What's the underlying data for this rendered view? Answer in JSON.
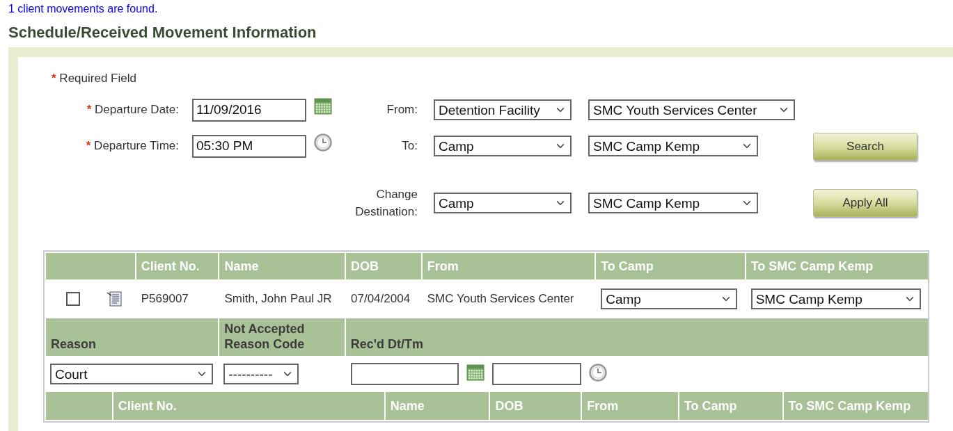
{
  "status_message": "1 client movements are found.",
  "section_title": "Schedule/Received Movement Information",
  "form": {
    "required_note": {
      "mark": "*",
      "text": "Required Field"
    },
    "departure_date": {
      "required_mark": "*",
      "label": "Departure Date:",
      "value": "11/09/2016"
    },
    "departure_time": {
      "required_mark": "*",
      "label": "Departure Time:",
      "value": "05:30 PM"
    },
    "from": {
      "label": "From:",
      "type": "Detention Facility",
      "facility": "SMC Youth Services Center"
    },
    "to": {
      "label": "To:",
      "type": "Camp",
      "facility": "SMC Camp Kemp"
    },
    "search_button": "Search",
    "change_destination": {
      "label": "Change Destination:",
      "type": "Camp",
      "facility": "SMC Camp Kemp"
    },
    "apply_button": "Apply All"
  },
  "clients_table": {
    "columns": [
      "Client No.",
      "Name",
      "DOB",
      "From",
      "To Camp",
      "To SMC Camp Kemp"
    ],
    "rows": [
      {
        "checked": false,
        "client_no": "P569007",
        "name": "Smith, John Paul JR",
        "dob": "07/04/2004",
        "from": "SMC Youth Services Center",
        "to_camp": "Camp",
        "to_facility": "SMC Camp Kemp"
      }
    ]
  },
  "detail_table": {
    "columns": [
      "Reason",
      "Not Accepted Reason Code",
      "Rec'd Dt/Tm"
    ],
    "reason": "Court",
    "not_accepted_reason_code": "----------"
  },
  "second_table": {
    "columns": [
      "Client No.",
      "Name",
      "DOB",
      "From",
      "To Camp",
      "To SMC Camp Kemp"
    ]
  }
}
